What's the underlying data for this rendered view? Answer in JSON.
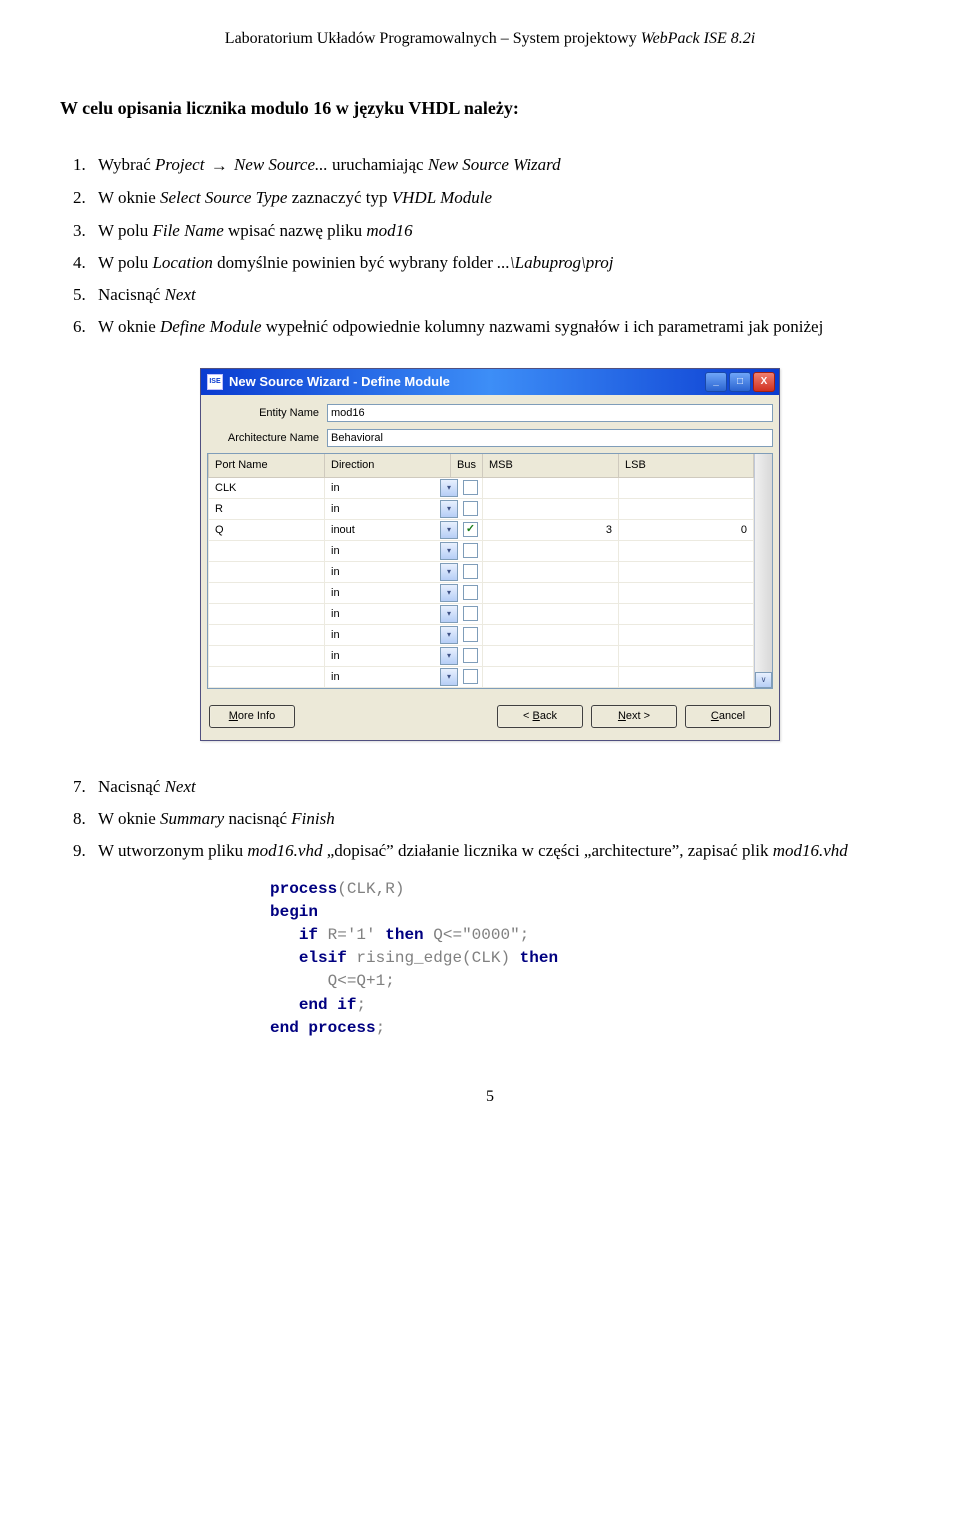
{
  "header": {
    "prefix": "Laboratorium Układów Programowalnych – System projektowy ",
    "italic": "WebPack ISE 8.2i"
  },
  "heading": "W celu opisania licznika modulo 16 w języku VHDL należy:",
  "steps": {
    "1a": "Wybrać ",
    "1b": "Project",
    "1c": "New Source...",
    "1d": " uruchamiając ",
    "1e": "New Source Wizard",
    "2a": "W oknie ",
    "2b": "Select Source Type",
    "2c": " zaznaczyć typ ",
    "2d": "VHDL Module",
    "3a": "W polu ",
    "3b": "File Name",
    "3c": " wpisać nazwę pliku ",
    "3d": "mod16",
    "4a": "W polu ",
    "4b": "Location",
    "4c": " domyślnie powinien być wybrany folder ",
    "4d": "...\\Labuprog\\proj",
    "5a": "Nacisnąć ",
    "5b": "Next",
    "6a": "W oknie ",
    "6b": "Define Module",
    "6c": " wypełnić odpowiednie kolumny nazwami sygnałów i ich parametrami jak poniżej",
    "7a": "Nacisnąć ",
    "7b": "Next",
    "8a": "W oknie ",
    "8b": "Summary",
    "8c": " nacisnąć ",
    "8d": "Finish",
    "9a": "W utworzonym pliku ",
    "9b": "mod16.vhd",
    "9c": " „dopisać” działanie licznika w części „architecture”, zapisać plik ",
    "9d": "mod16.vhd"
  },
  "dialog": {
    "title": "New Source Wizard - Define Module",
    "entity_label": "Entity Name",
    "entity_value": "mod16",
    "arch_label": "Architecture Name",
    "arch_value": "Behavioral",
    "cols": {
      "port": "Port Name",
      "dir": "Direction",
      "bus": "Bus",
      "msb": "MSB",
      "lsb": "LSB"
    },
    "rows": [
      {
        "port": "CLK",
        "dir": "in",
        "bus": false,
        "msb": "",
        "lsb": ""
      },
      {
        "port": "R",
        "dir": "in",
        "bus": false,
        "msb": "",
        "lsb": ""
      },
      {
        "port": "Q",
        "dir": "inout",
        "bus": true,
        "msb": "3",
        "lsb": "0"
      },
      {
        "port": "",
        "dir": "in",
        "bus": false,
        "msb": "",
        "lsb": ""
      },
      {
        "port": "",
        "dir": "in",
        "bus": false,
        "msb": "",
        "lsb": ""
      },
      {
        "port": "",
        "dir": "in",
        "bus": false,
        "msb": "",
        "lsb": ""
      },
      {
        "port": "",
        "dir": "in",
        "bus": false,
        "msb": "",
        "lsb": ""
      },
      {
        "port": "",
        "dir": "in",
        "bus": false,
        "msb": "",
        "lsb": ""
      },
      {
        "port": "",
        "dir": "in",
        "bus": false,
        "msb": "",
        "lsb": ""
      },
      {
        "port": "",
        "dir": "in",
        "bus": false,
        "msb": "",
        "lsb": ""
      }
    ],
    "buttons": {
      "more_prefix": "M",
      "more_rest": "ore Info",
      "back_prefix": "< ",
      "back_u": "B",
      "back_rest": "ack",
      "next_u": "N",
      "next_rest": "ext >",
      "cancel_u": "C",
      "cancel_rest": "ancel"
    }
  },
  "code": {
    "l1a": "process",
    "l1b": "(CLK,R)",
    "l2": "begin",
    "l3a": "if",
    "l3b": " R=",
    "l3c": "'1'",
    "l3d": " ",
    "l3e": "then",
    "l3f": " Q<=",
    "l3g": "\"0000\"",
    "l3h": ";",
    "l4a": "elsif",
    "l4b": " rising_edge(CLK) ",
    "l4c": "then",
    "l5": "Q<=Q+1;",
    "l6a": "end",
    "l6b": " ",
    "l6c": "if",
    "l6d": ";",
    "l7a": "end",
    "l7b": " ",
    "l7c": "process",
    "l7d": ";"
  },
  "page_number": "5"
}
